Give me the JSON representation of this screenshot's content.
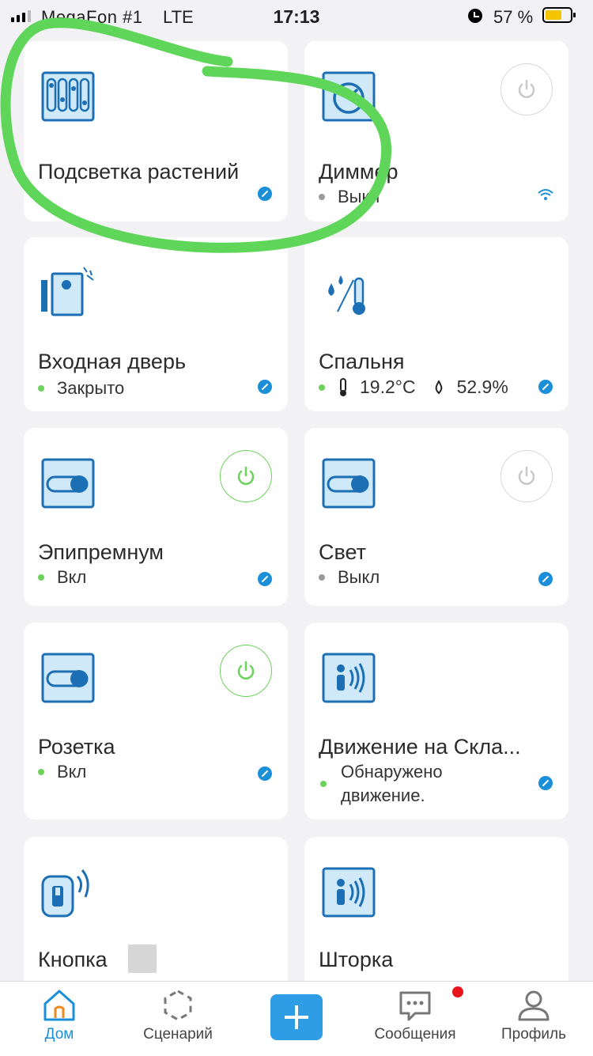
{
  "status_bar": {
    "carrier": "MegaFon #1",
    "network": "LTE",
    "time": "17:13",
    "battery": "57 %"
  },
  "colors": {
    "accent": "#1b8fd8",
    "on_green": "#6bd35a",
    "off_grey": "#9a9a9a",
    "annotation": "#5fd65a"
  },
  "cards": [
    {
      "title": "Подсветка растений",
      "icon": "led-strip-icon"
    },
    {
      "title": "Диммер",
      "status": "Выкл",
      "icon": "dimmer-icon",
      "power": "off"
    },
    {
      "title": "Входная дверь",
      "status": "Закрыто",
      "icon": "door-sensor-icon"
    },
    {
      "title": "Спальня",
      "temperature": "19.2°C",
      "humidity": "52.9%",
      "icon": "climate-sensor-icon"
    },
    {
      "title": "Эпипремнум",
      "status": "Вкл",
      "icon": "switch-icon",
      "power": "on"
    },
    {
      "title": "Свет",
      "status": "Выкл",
      "icon": "switch-icon",
      "power": "off"
    },
    {
      "title": "Розетка",
      "status": "Вкл",
      "icon": "switch-icon",
      "power": "on"
    },
    {
      "title": "Движение на Скла...",
      "status_line1": "Обнаружено",
      "status_line2": "движение.",
      "icon": "motion-sensor-icon"
    },
    {
      "title": "Кнопка",
      "icon": "remote-button-icon"
    },
    {
      "title": "Шторка",
      "icon": "motion-sensor-icon"
    }
  ],
  "tabs": [
    {
      "label": "Дом",
      "icon": "home-icon",
      "active": true
    },
    {
      "label": "Сценарий",
      "icon": "scenario-icon"
    },
    {
      "label": "",
      "icon": "add-icon"
    },
    {
      "label": "Сообщения",
      "icon": "messages-icon"
    },
    {
      "label": "Профиль",
      "icon": "profile-icon"
    }
  ]
}
